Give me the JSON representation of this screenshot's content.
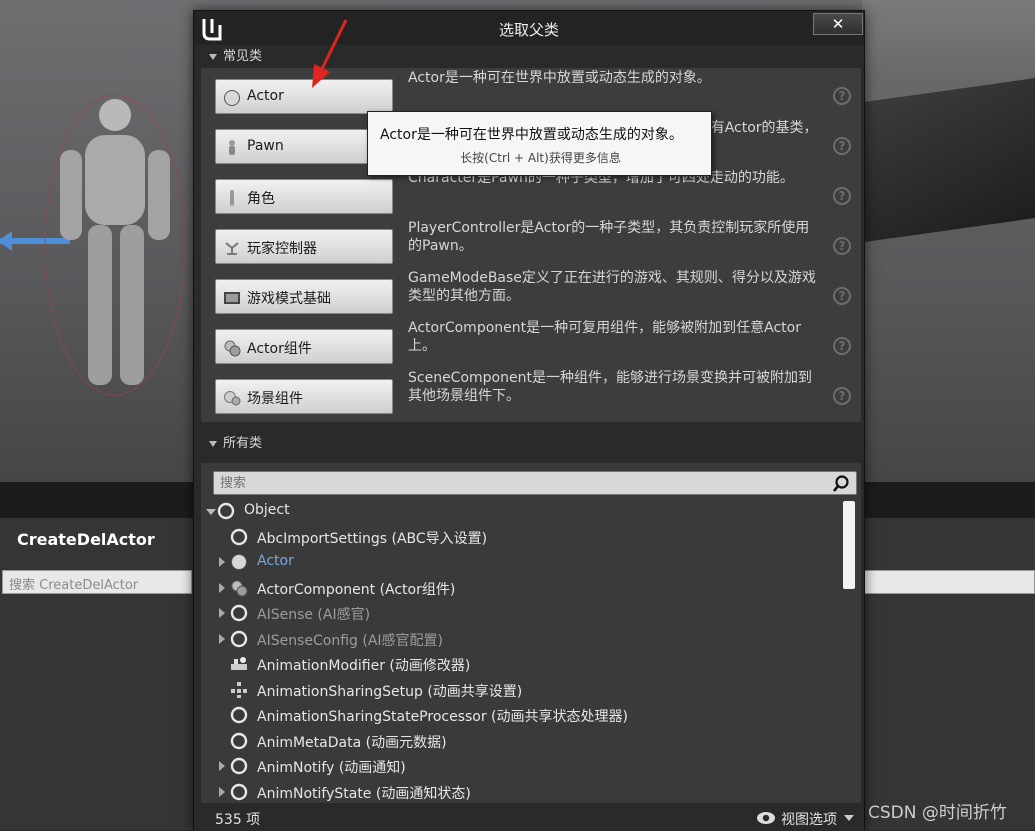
{
  "dialog": {
    "title": "选取父类",
    "close_label": "✕",
    "common_section": "常见类",
    "all_section": "所有类"
  },
  "common_classes": [
    {
      "label": "Actor",
      "icon": "sphere-icon",
      "desc": "Actor是一种可在世界中放置或动态生成的对象。"
    },
    {
      "label": "Pawn",
      "icon": "pawn-icon",
      "desc": "Pawn是可以被控制并接收来自控制器的输入的所有Actor的基类，也可以接收来自"
    },
    {
      "label": "角色",
      "icon": "character-icon",
      "desc": "Character是Pawn的一种子类型，增加了可四处走动的功能。"
    },
    {
      "label": "玩家控制器",
      "icon": "player-controller-icon",
      "desc": "PlayerController是Actor的一种子类型，其负责控制玩家所使用的Pawn。"
    },
    {
      "label": "游戏模式基础",
      "icon": "game-mode-icon",
      "desc": "GameModeBase定义了正在进行的游戏、其规则、得分以及游戏类型的其他方面。"
    },
    {
      "label": "Actor组件",
      "icon": "actor-component-icon",
      "desc": "ActorComponent是一种可复用组件，能够被附加到任意Actor上。"
    },
    {
      "label": "场景组件",
      "icon": "scene-component-icon",
      "desc": "SceneComponent是一种组件，能够进行场景变换并可被附加到其他场景组件下。"
    }
  ],
  "tooltip": {
    "title": "Actor是一种可在世界中放置或动态生成的对象。",
    "hint": "长按(Ctrl + Alt)获得更多信息"
  },
  "search": {
    "placeholder": "搜索"
  },
  "tree": [
    {
      "label": "Object",
      "expander": "down",
      "icon": "circle-icon",
      "style": "normal",
      "indent": 0
    },
    {
      "label": "AbcImportSettings (ABC导入设置)",
      "expander": "none",
      "icon": "circle-icon",
      "style": "normal",
      "indent": 1
    },
    {
      "label": "Actor",
      "expander": "right",
      "icon": "sphere-icon",
      "style": "blue",
      "indent": 1
    },
    {
      "label": "ActorComponent (Actor组件)",
      "expander": "right",
      "icon": "actor-component-icon",
      "style": "normal",
      "indent": 1
    },
    {
      "label": "AISense (AI感官)",
      "expander": "right",
      "icon": "circle-icon",
      "style": "dim",
      "indent": 1
    },
    {
      "label": "AISenseConfig (AI感官配置)",
      "expander": "right",
      "icon": "circle-icon",
      "style": "dim",
      "indent": 1
    },
    {
      "label": "AnimationModifier (动画修改器)",
      "expander": "none",
      "icon": "modifier-icon",
      "style": "normal",
      "indent": 1
    },
    {
      "label": "AnimationSharingSetup (动画共享设置)",
      "expander": "none",
      "icon": "sharing-icon",
      "style": "normal",
      "indent": 1
    },
    {
      "label": "AnimationSharingStateProcessor (动画共享状态处理器)",
      "expander": "none",
      "icon": "circle-icon",
      "style": "normal",
      "indent": 1
    },
    {
      "label": "AnimMetaData (动画元数据)",
      "expander": "none",
      "icon": "circle-icon",
      "style": "normal",
      "indent": 1
    },
    {
      "label": "AnimNotify (动画通知)",
      "expander": "right",
      "icon": "circle-icon",
      "style": "normal",
      "indent": 1
    },
    {
      "label": "AnimNotifyState (动画通知状态)",
      "expander": "right",
      "icon": "circle-icon",
      "style": "normal",
      "indent": 1
    }
  ],
  "footer": {
    "count": "535 项",
    "view_options": "视图选项"
  },
  "background": {
    "blueprint_title": "CreateDelActor",
    "blueprint_search_placeholder": "搜索 CreateDelActor",
    "watermark": "CSDN @时间折竹"
  }
}
